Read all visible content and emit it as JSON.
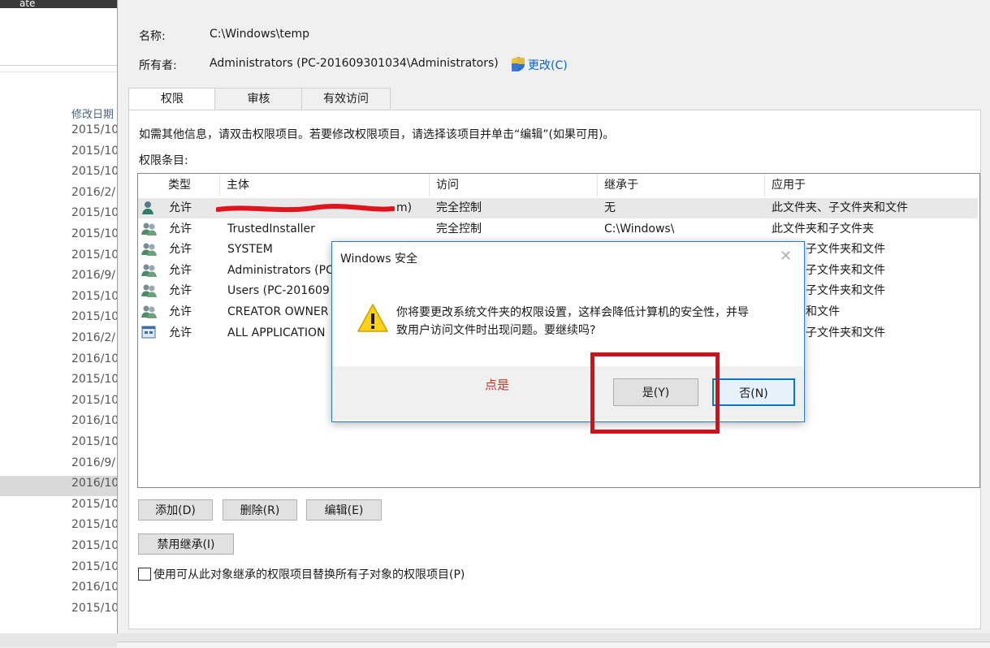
{
  "background": {
    "top_text": "ate",
    "column_header": "修改日期",
    "dates": [
      "2015/10",
      "2015/10",
      "2015/10",
      "2016/2/",
      "2015/10",
      "2015/10",
      "2015/10",
      "2016/9/",
      "2015/10",
      "2015/10",
      "2016/2/",
      "2016/10",
      "2015/10",
      "2015/10",
      "2016/10",
      "2015/10",
      "2016/9/",
      "2016/10",
      "2015/10",
      "2015/10",
      "2015/10",
      "2015/10",
      "2016/10",
      "2015/10"
    ]
  },
  "dialog": {
    "name_label": "名称:",
    "name_value": "C:\\Windows\\temp",
    "owner_label": "所有者:",
    "owner_value": "Administrators (PC-201609301034\\Administrators)",
    "change_link": "更改(C)",
    "tabs": [
      {
        "label": "权限"
      },
      {
        "label": "审核"
      },
      {
        "label": "有效访问"
      }
    ],
    "info_text": "如需其他信息，请双击权限项目。若要修改权限项目，请选择该项目并单击“编辑”(如果可用)。",
    "entries_label": "权限条目:",
    "table": {
      "headers": [
        "类型",
        "主体",
        "访问",
        "继承于",
        "应用于"
      ],
      "rows": [
        {
          "type": "允许",
          "principal": "m)",
          "access": "完全控制",
          "inherited_from": "无",
          "applies_to": "此文件夹、子文件夹和文件",
          "icon": "user-icon"
        },
        {
          "type": "允许",
          "principal": "TrustedInstaller",
          "access": "完全控制",
          "inherited_from": "C:\\Windows\\",
          "applies_to": "此文件夹和子文件夹",
          "icon": "group-icon"
        },
        {
          "type": "允许",
          "principal": "SYSTEM",
          "access": "",
          "inherited_from": "",
          "applies_to": "件夹、子文件夹和文件",
          "icon": "group-icon"
        },
        {
          "type": "允许",
          "principal": "Administrators (PC",
          "access": "",
          "inherited_from": "",
          "applies_to": "件夹、子文件夹和文件",
          "icon": "group-icon"
        },
        {
          "type": "允许",
          "principal": "Users (PC-201609",
          "access": "",
          "inherited_from": "",
          "applies_to": "件夹、子文件夹和文件",
          "icon": "group-icon"
        },
        {
          "type": "允许",
          "principal": "CREATOR OWNER",
          "access": "",
          "inherited_from": "",
          "applies_to": "文件夹和文件",
          "icon": "group-icon"
        },
        {
          "type": "允许",
          "principal": "ALL APPLICATION",
          "access": "",
          "inherited_from": "",
          "applies_to": "件夹、子文件夹和文件",
          "icon": "app-package-icon"
        }
      ]
    },
    "buttons": {
      "add": "添加(D)",
      "remove": "删除(R)",
      "edit": "编辑(E)",
      "disable_inheritance": "禁用继承(I)"
    },
    "replace_checkbox_label": "使用可从此对象继承的权限项目替换所有子对象的权限项目(P)"
  },
  "popup": {
    "title": "Windows 安全",
    "close": "✕",
    "message_line1": "你将要更改系统文件夹的权限设置，这样会降低计算机的安全性，并导",
    "message_line2": "致用户访问文件时出现问题。要继续吗?",
    "yes": "是(Y)",
    "no": "否(N)",
    "annotation": "点是"
  },
  "colors": {
    "link": "#0066cc",
    "annotation_red": "#d0101a",
    "focus_blue": "#0078d7"
  }
}
